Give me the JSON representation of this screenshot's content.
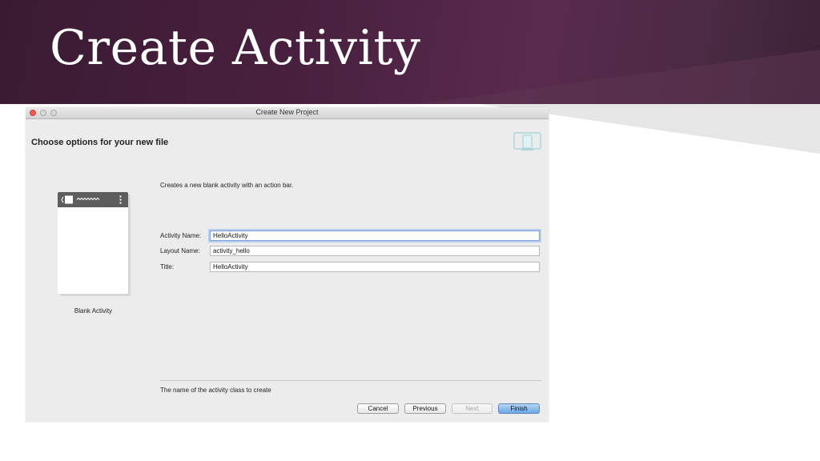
{
  "slide": {
    "title": "Create Activity"
  },
  "window": {
    "title": "Create New Project"
  },
  "page": {
    "heading": "Choose options for your new file",
    "description": "Creates a new blank activity with an action bar.",
    "hint": "The name of the activity class to create"
  },
  "template": {
    "label": "Blank Activity"
  },
  "form": {
    "activity_name": {
      "label": "Activity Name:",
      "value": "HelloActivity"
    },
    "layout_name": {
      "label": "Layout Name:",
      "value": "activity_hello"
    },
    "title": {
      "label": "Title:",
      "value": "HelloActivity"
    }
  },
  "buttons": {
    "cancel": "Cancel",
    "previous": "Previous",
    "next": "Next",
    "finish": "Finish"
  },
  "colors": {
    "banner": "#4a2140",
    "focus_ring": "#7aa4d8",
    "primary_button": "#6aa7e6",
    "close_button": "#ee5a52"
  },
  "icons": [
    "android-device-icon",
    "back-arrow-icon",
    "overflow-menu-icon"
  ]
}
